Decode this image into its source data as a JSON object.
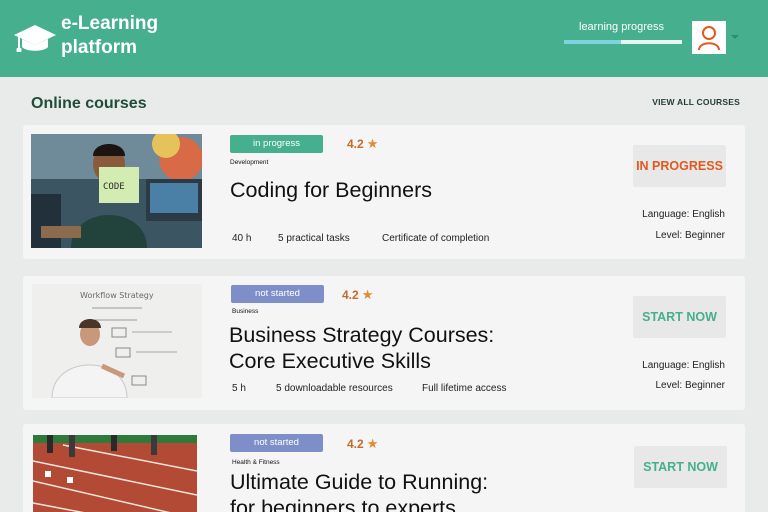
{
  "header": {
    "brand": "e-Learning platform",
    "brand_line1": "e-Learning",
    "brand_line2": "platform",
    "progress_label": "learning progress",
    "progress_value": 0.48
  },
  "section": {
    "title": "Online courses",
    "view_all": "VIEW ALL COURSES"
  },
  "colors": {
    "header": "#45af8e",
    "in_progress_badge": "#45af8e",
    "not_started_badge": "#7d8ec8",
    "in_progress_action": "#e2591e",
    "start_action": "#45af8e"
  },
  "courses": [
    {
      "status": "in progress",
      "rating": "4.2",
      "category": "Development",
      "title_line1": "Coding for Beginners",
      "meta": [
        "40 h",
        "5 practical tasks",
        "Certificate of completion"
      ],
      "action": "IN PROGRESS",
      "language": "Language: English",
      "level": "Level: Beginner"
    },
    {
      "status": "not started",
      "rating": "4.2",
      "category": "Business",
      "title_line1": "Business Strategy Courses:",
      "title_line2": "Core Executive Skills",
      "meta": [
        "5  h",
        "5 downloadable resources",
        "Full lifetime access"
      ],
      "action": "START NOW",
      "language": "Language: English",
      "level": "Level: Beginner"
    },
    {
      "status": "not started",
      "rating": "4.2",
      "category": "Health & Fitness",
      "title_line1": "Ultimate Guide to Running:",
      "title_line2": "for beginners to experts",
      "action": "START NOW"
    }
  ]
}
